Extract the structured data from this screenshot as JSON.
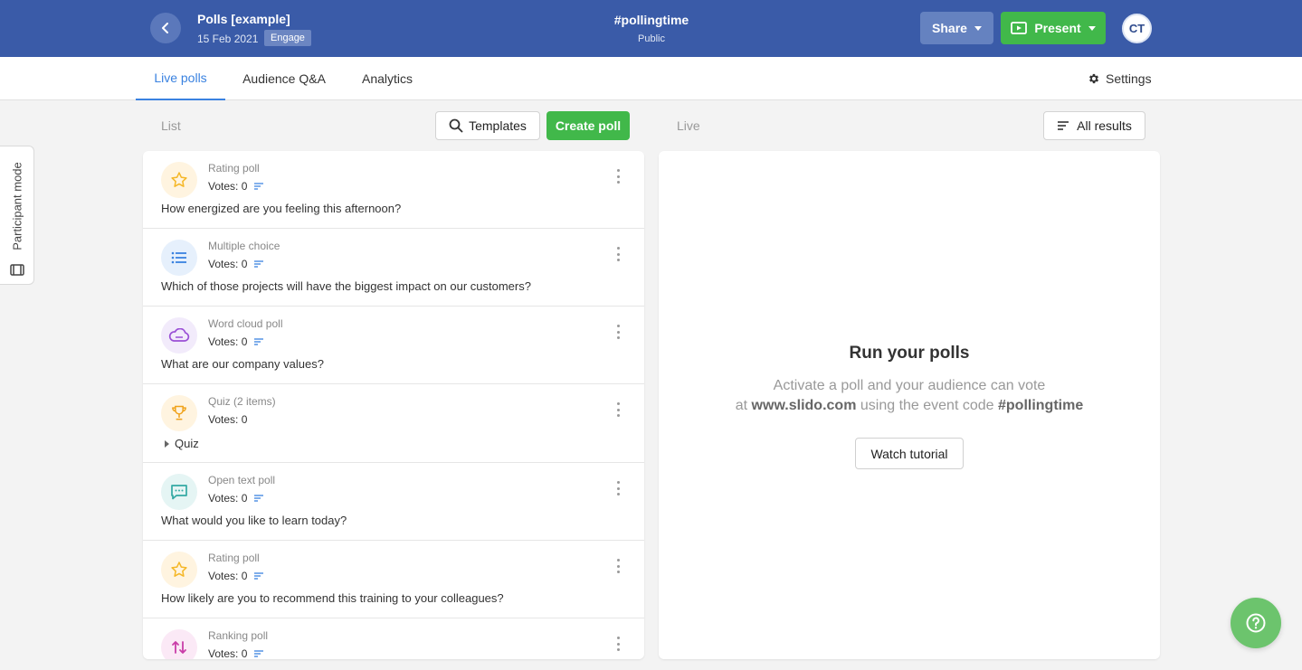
{
  "header": {
    "title": "Polls [example]",
    "date": "15 Feb 2021",
    "badge": "Engage",
    "event_code": "#pollingtime",
    "privacy": "Public",
    "share_label": "Share",
    "present_label": "Present",
    "avatar_initials": "CT",
    "bar_color": "#3a5ba8",
    "present_color": "#41b84a"
  },
  "tabs": {
    "live_polls": "Live polls",
    "audience_qa": "Audience Q&A",
    "analytics": "Analytics",
    "settings": "Settings",
    "active_color": "#3a82e0"
  },
  "side": {
    "participant_mode": "Participant mode"
  },
  "toolbar": {
    "list_label": "List",
    "templates_label": "Templates",
    "create_poll_label": "Create poll",
    "live_label": "Live",
    "all_results_label": "All results"
  },
  "polls": [
    {
      "type": "Rating poll",
      "votes": "Votes: 0",
      "question": "How energized are you feeling this afternoon?",
      "icon": "star-icon"
    },
    {
      "type": "Multiple choice",
      "votes": "Votes: 0",
      "question": "Which of those projects will have the biggest impact on our customers?",
      "icon": "list-icon"
    },
    {
      "type": "Word cloud poll",
      "votes": "Votes: 0",
      "question": "What are our company values?",
      "icon": "cloud-icon"
    },
    {
      "type": "Quiz (2 items)",
      "votes": "Votes: 0",
      "question": "Quiz",
      "icon": "trophy-icon"
    },
    {
      "type": "Open text poll",
      "votes": "Votes: 0",
      "question": "What would you like to learn today?",
      "icon": "chat-icon"
    },
    {
      "type": "Rating poll",
      "votes": "Votes: 0",
      "question": "How likely are you to recommend this training to your colleagues?",
      "icon": "star-icon"
    },
    {
      "type": "Ranking poll",
      "votes": "Votes: 0",
      "question": "",
      "icon": "ranking-icon"
    }
  ],
  "live_panel": {
    "title": "Run your polls",
    "line1": "Activate a poll and your audience can vote",
    "line2_prefix": "at",
    "site": "www.slido.com",
    "line2_mid": "using the event code",
    "code": "#pollingtime",
    "watch_label": "Watch tutorial"
  },
  "help": {
    "icon": "help-icon",
    "color": "#6cc46d"
  }
}
